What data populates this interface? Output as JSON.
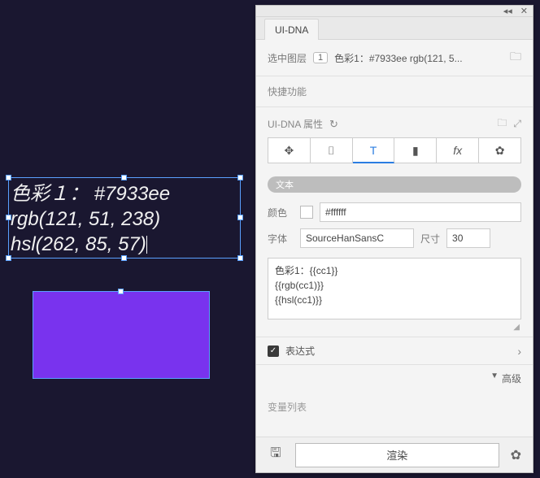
{
  "canvas": {
    "text_line1": "色彩１： #7933ee",
    "text_line2": "rgb(121, 51, 238)",
    "text_line3": "hsl(262, 85, 57)",
    "rect_color": "#7933ee"
  },
  "panel": {
    "tab": "UI-DNA",
    "selected_label": "选中图层",
    "selected_count": "1",
    "selected_name": "色彩1：#7933ee rgb(121, 5...",
    "quick_label": "快捷功能",
    "props_title": "UI-DNA 属性",
    "pill": "文本",
    "color_label": "颜色",
    "color_value": "#ffffff",
    "font_label": "字体",
    "font_value": "SourceHanSansC",
    "size_label": "尺寸",
    "size_value": "30",
    "textarea_value": "色彩1：{{cc1}}\n{{rgb(cc1)}}\n{{hsl(cc1)}}",
    "expr_label": "表达式",
    "adv_label": "高级",
    "varlist_label": "变量列表",
    "render_btn": "渲染"
  }
}
